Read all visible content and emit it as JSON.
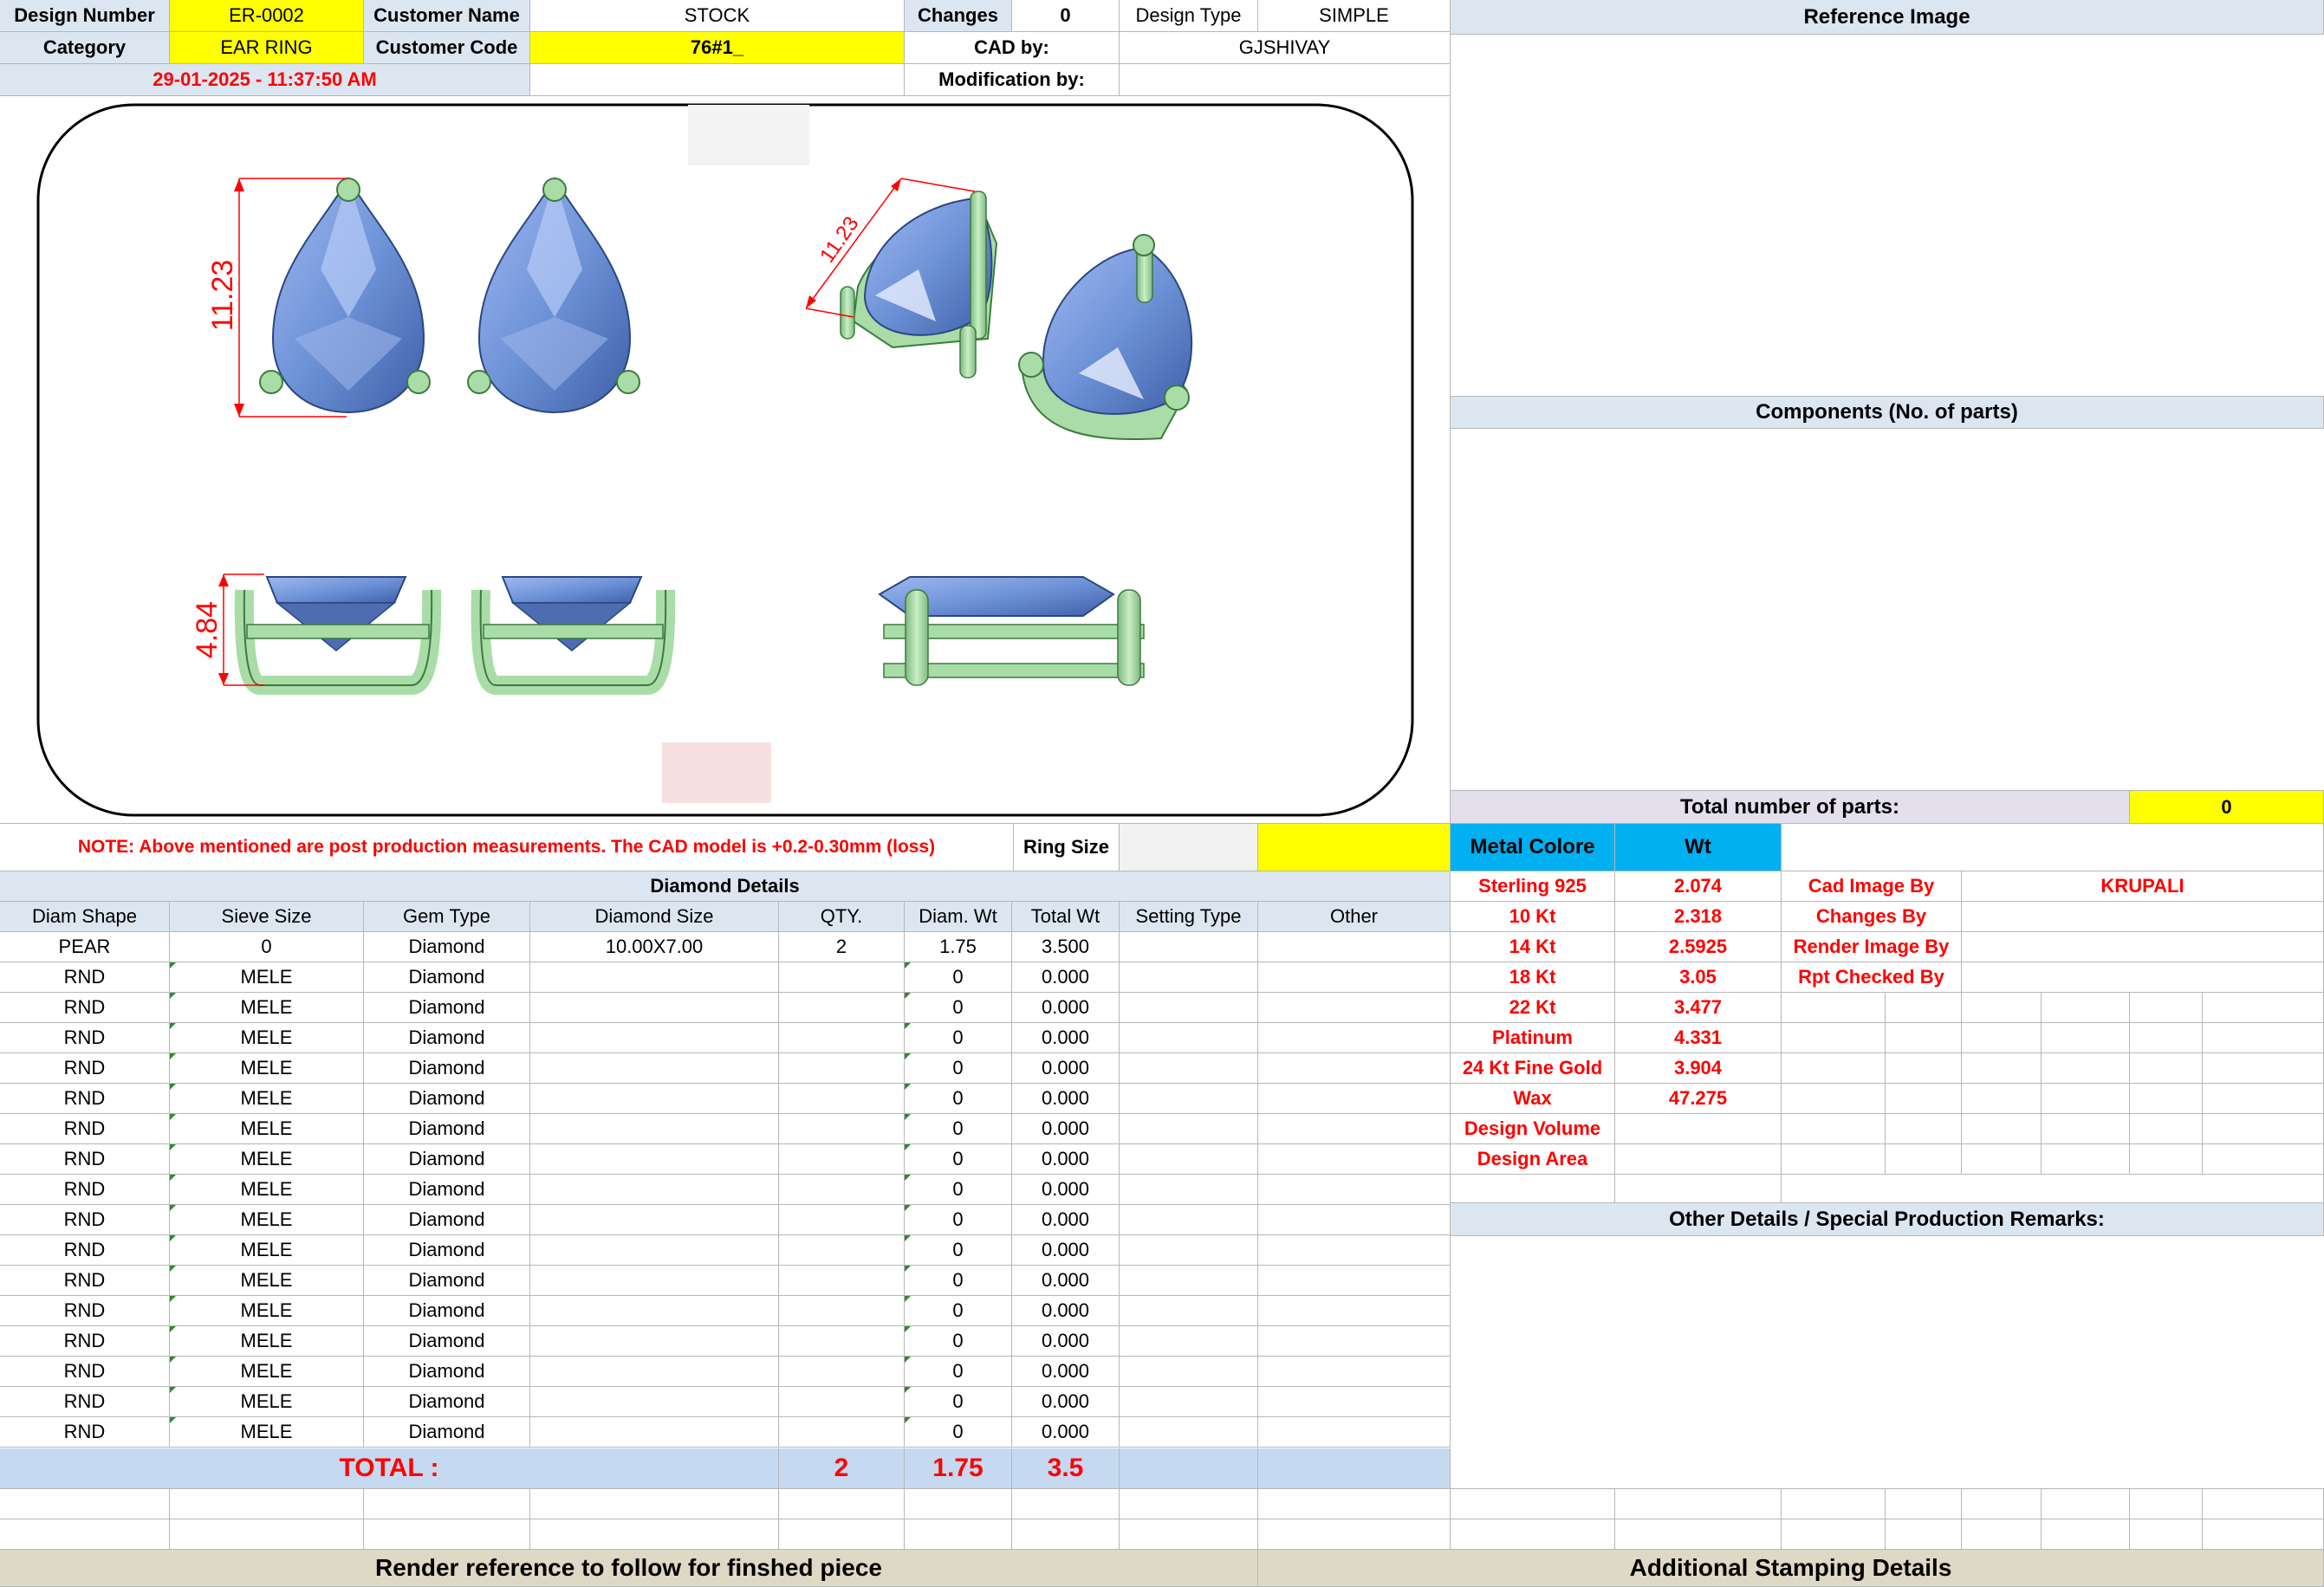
{
  "header": {
    "design_number_label": "Design Number",
    "design_number": "ER-0002",
    "customer_name_label": "Customer Name",
    "customer_name": "STOCK",
    "changes_label": "Changes",
    "changes": "0",
    "design_type_label": "Design Type",
    "design_type": "SIMPLE",
    "category_label": "Category",
    "category": "EAR RING",
    "customer_code_label": "Customer Code",
    "customer_code": "76#1_",
    "cad_by_label": "CAD by:",
    "cad_by": "GJSHIVAY",
    "timestamp": "29-01-2025 - 11:37:50 AM",
    "modification_by_label": "Modification by:"
  },
  "drawing": {
    "dim_length_front": "11.23",
    "dim_length_perspective": "11.23",
    "dim_height": "4.84"
  },
  "note": "NOTE: Above mentioned are post production measurements. The CAD model is +0.2-0.30mm (loss)",
  "ring_size_label": "Ring Size",
  "diamond_details": {
    "title": "Diamond Details",
    "columns": [
      "Diam Shape",
      "Sieve Size",
      "Gem Type",
      "Diamond Size",
      "QTY.",
      "Diam. Wt",
      "Total Wt",
      "Setting Type",
      "Other"
    ],
    "rows": [
      [
        "PEAR",
        "0",
        "Diamond",
        "10.00X7.00",
        "2",
        "1.75",
        "3.500",
        "",
        ""
      ],
      [
        "RND",
        "MELE",
        "Diamond",
        "",
        "",
        "0",
        "0.000",
        "",
        ""
      ],
      [
        "RND",
        "MELE",
        "Diamond",
        "",
        "",
        "0",
        "0.000",
        "",
        ""
      ],
      [
        "RND",
        "MELE",
        "Diamond",
        "",
        "",
        "0",
        "0.000",
        "",
        ""
      ],
      [
        "RND",
        "MELE",
        "Diamond",
        "",
        "",
        "0",
        "0.000",
        "",
        ""
      ],
      [
        "RND",
        "MELE",
        "Diamond",
        "",
        "",
        "0",
        "0.000",
        "",
        ""
      ],
      [
        "RND",
        "MELE",
        "Diamond",
        "",
        "",
        "0",
        "0.000",
        "",
        ""
      ],
      [
        "RND",
        "MELE",
        "Diamond",
        "",
        "",
        "0",
        "0.000",
        "",
        ""
      ],
      [
        "RND",
        "MELE",
        "Diamond",
        "",
        "",
        "0",
        "0.000",
        "",
        ""
      ],
      [
        "RND",
        "MELE",
        "Diamond",
        "",
        "",
        "0",
        "0.000",
        "",
        ""
      ],
      [
        "RND",
        "MELE",
        "Diamond",
        "",
        "",
        "0",
        "0.000",
        "",
        ""
      ],
      [
        "RND",
        "MELE",
        "Diamond",
        "",
        "",
        "0",
        "0.000",
        "",
        ""
      ],
      [
        "RND",
        "MELE",
        "Diamond",
        "",
        "",
        "0",
        "0.000",
        "",
        ""
      ],
      [
        "RND",
        "MELE",
        "Diamond",
        "",
        "",
        "0",
        "0.000",
        "",
        ""
      ],
      [
        "RND",
        "MELE",
        "Diamond",
        "",
        "",
        "0",
        "0.000",
        "",
        ""
      ],
      [
        "RND",
        "MELE",
        "Diamond",
        "",
        "",
        "0",
        "0.000",
        "",
        ""
      ],
      [
        "RND",
        "MELE",
        "Diamond",
        "",
        "",
        "0",
        "0.000",
        "",
        ""
      ]
    ],
    "total_label": "TOTAL :",
    "total_qty": "2",
    "total_diam_wt": "1.75",
    "total_wt": "3.5"
  },
  "right_panel": {
    "reference_image_title": "Reference Image",
    "components_title": "Components (No. of parts)",
    "total_parts_label": "Total number of parts:",
    "total_parts": "0",
    "metal_colore_label": "Metal Colore",
    "wt_label": "Wt",
    "metals": [
      {
        "name": "Sterling 925",
        "wt": "2.074"
      },
      {
        "name": "10 Kt",
        "wt": "2.318"
      },
      {
        "name": "14 Kt",
        "wt": "2.5925"
      },
      {
        "name": "18 Kt",
        "wt": "3.05"
      },
      {
        "name": "22 Kt",
        "wt": "3.477"
      },
      {
        "name": "Platinum",
        "wt": "4.331"
      },
      {
        "name": "24 Kt Fine Gold",
        "wt": "3.904"
      },
      {
        "name": "Wax",
        "wt": "47.275"
      },
      {
        "name": "Design Volume",
        "wt": ""
      },
      {
        "name": "Design Area",
        "wt": ""
      }
    ],
    "credits": [
      {
        "label": "Cad Image By",
        "value": "KRUPALI"
      },
      {
        "label": "Changes By",
        "value": ""
      },
      {
        "label": "Render Image By",
        "value": ""
      },
      {
        "label": "Rpt Checked By",
        "value": ""
      }
    ],
    "other_details_title": "Other Details / Special Production Remarks:"
  },
  "footer": {
    "render_reference": "Render reference to follow for finshed piece",
    "stamping": "Additional Stamping Details"
  },
  "colors": {
    "header_blue": "#dce6f1",
    "yellow": "#ffff00",
    "metal_blue": "#00b0f0",
    "total_row": "#c5d9f1",
    "footer_tan": "#ddd9c4",
    "parts_lavender": "#e4dfec",
    "stone_blue": "#6f93d8",
    "prong_green": "#a9dca6"
  }
}
